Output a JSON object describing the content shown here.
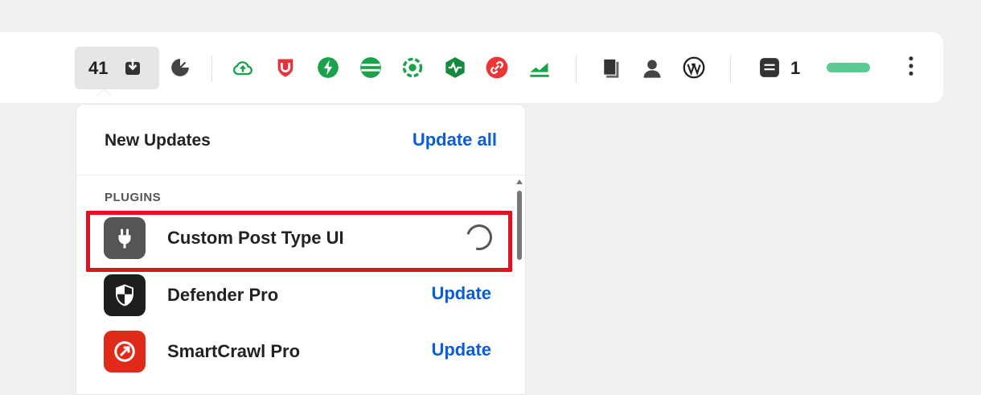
{
  "toolbar": {
    "updates_count": "41",
    "notifications_count": "1",
    "icons": [
      "download-icon",
      "analytics-icon",
      "cloud-upload-icon",
      "shield-u-icon",
      "bolt-icon",
      "stack-icon",
      "gear-target-icon",
      "pulse-hex-icon",
      "link-icon",
      "chart-up-icon",
      "pages-icon",
      "user-icon",
      "wordpress-icon",
      "comments-icon",
      "more-vertical-icon"
    ],
    "accent_green": "#5bcb91"
  },
  "panel": {
    "title": "New Updates",
    "update_all_label": "Update all",
    "section_label": "PLUGINS",
    "plugins": [
      {
        "name": "Custom Post Type UI",
        "status": "loading",
        "icon": "plug-icon",
        "icon_bg": "#555555"
      },
      {
        "name": "Defender Pro",
        "action": "Update",
        "icon": "shield-icon",
        "icon_bg": "#1e1e1e"
      },
      {
        "name": "SmartCrawl Pro",
        "action": "Update",
        "icon": "smartcrawl-icon",
        "icon_bg": "#e12b1a"
      }
    ]
  },
  "colors": {
    "link": "#0b5ed7",
    "highlight": "#e0131f"
  }
}
